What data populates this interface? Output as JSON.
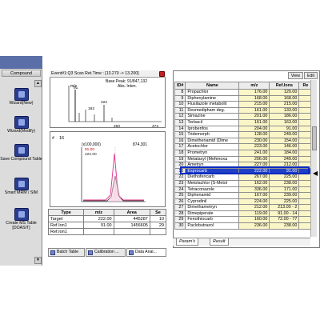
{
  "sidebar": {
    "header": "Compound",
    "tools": [
      {
        "label": "Wizard(New)",
        "icon": "wizard-new-icon"
      },
      {
        "label": "Wizard(Modify)",
        "icon": "wizard-modify-icon"
      },
      {
        "label": "Save Compound Table",
        "icon": "save-table-icon"
      },
      {
        "label": "Smart MRM / SIM",
        "icon": "smart-mrm-icon"
      },
      {
        "label": "Create MS Table [DOASIT]",
        "icon": "create-ms-table-icon"
      }
    ]
  },
  "chromatogram": {
    "title": "Event#1:Q3 Scan  Ret.Time : [13.270 -> 13.200]",
    "base_peak": "Base Peak: 91/847,132",
    "mz": "m/z",
    "abs_label": "Abs. Inten.",
    "peak_labels": [
      "91",
      "162",
      "222",
      "250"
    ],
    "axis_end": "472",
    "axis_mid": "250"
  },
  "peak_panel": {
    "id": "16",
    "scale": "(x100,000)",
    "value1": "91.00",
    "value2": "222.00",
    "right_value": "874,301"
  },
  "type_table": {
    "headers": [
      "Type",
      "m/z",
      "Area",
      "Se"
    ],
    "rows": [
      [
        "Target",
        "222.00",
        "445287",
        "10"
      ],
      [
        "Ref.Ion1",
        "91.00",
        "1456605",
        "29"
      ],
      [
        "Ref.Ion1",
        "",
        "",
        ""
      ]
    ]
  },
  "bottom_tabs": [
    "Batch Table",
    "Calibration ...",
    "Data Anal..."
  ],
  "right_panel": {
    "view_label": "View",
    "edit_label": "Edit",
    "headers": [
      "ID#",
      "Name",
      "m/z",
      "Ref.Ions",
      "Re"
    ],
    "rows": [
      [
        "8",
        "Propachlor",
        "176.00",
        "120.00"
      ],
      [
        "9",
        "Diphenylamine",
        "168.00",
        "168.00"
      ],
      [
        "10",
        "Flusilazole metabolit",
        "215.00",
        "215.00"
      ],
      [
        "11",
        "Desmedipham deg.",
        "161.00",
        "133.00"
      ],
      [
        "12",
        "Simazine",
        "201.00",
        "186.00"
      ],
      [
        "13",
        "Terbacil",
        "161.00",
        "163.00"
      ],
      [
        "14",
        "Iprobenfos",
        "204.00",
        "91.00"
      ],
      [
        "15",
        "Tridemorph",
        "128.00",
        "249.00"
      ],
      [
        "16",
        "Dimethenamid (Dime",
        "230.00",
        "154.00"
      ],
      [
        "17",
        "Acetochlor",
        "223.00",
        "146.00"
      ],
      [
        "18",
        "Prometryn",
        "241.00",
        "184.00"
      ],
      [
        "19",
        "Metalaxyl (Mefenoxa",
        "206.00",
        "249.00"
      ],
      [
        "20",
        "Ametryn",
        "227.00",
        "212.00"
      ],
      [
        "16",
        "Esprocarb",
        "222.00",
        "91.00"
      ],
      [
        "22",
        "Diethofencarb",
        "267.00",
        "225.00"
      ],
      [
        "23",
        "Metolachlor (S-Metol",
        "162.00",
        "238.00"
      ],
      [
        "24",
        "Tetraconazole",
        "336.00",
        "171.00"
      ],
      [
        "25",
        "Diphenamid",
        "167.00",
        "239.00"
      ],
      [
        "26",
        "Cyprodinil",
        "224.00",
        "225.00"
      ],
      [
        "27",
        "Dimethametryn",
        "212.00",
        "213.00 - 2"
      ],
      [
        "28",
        "Dimepiperate",
        "119.00",
        "91.00 - 14"
      ],
      [
        "29",
        "Fenothiocarb",
        "160.00",
        "72.00 - 77"
      ],
      [
        "30",
        "Paclobutrazol",
        "236.00",
        "238.00"
      ]
    ],
    "selected_index": 13,
    "tabs": [
      "Param's",
      "Result"
    ]
  }
}
